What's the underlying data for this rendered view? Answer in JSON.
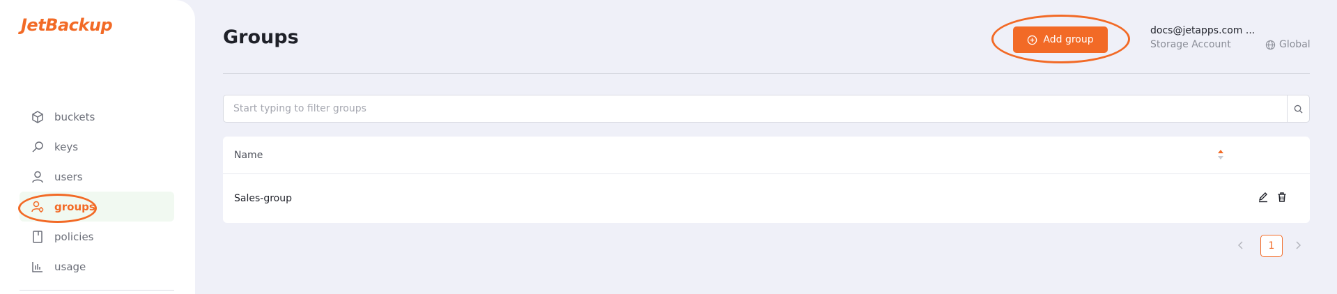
{
  "brand": {
    "logo_text": "JetBackup",
    "accent": "#f26a26"
  },
  "sidebar": {
    "items": [
      {
        "label": "buckets",
        "icon": "cube-icon",
        "active": false
      },
      {
        "label": "keys",
        "icon": "key-icon",
        "active": false
      },
      {
        "label": "users",
        "icon": "user-icon",
        "active": false
      },
      {
        "label": "groups",
        "icon": "users-group-icon",
        "active": true
      },
      {
        "label": "policies",
        "icon": "document-icon",
        "active": false
      },
      {
        "label": "usage",
        "icon": "bar-chart-icon",
        "active": false
      }
    ]
  },
  "header": {
    "title": "Groups",
    "add_button_label": "Add group",
    "account_email": "docs@jetapps.com ...",
    "account_type": "Storage Account",
    "region_label": "Global"
  },
  "search": {
    "placeholder": "Start typing to filter groups",
    "value": ""
  },
  "table": {
    "columns": [
      "Name"
    ],
    "rows": [
      {
        "name": "Sales-group"
      }
    ]
  },
  "pagination": {
    "current_page": "1"
  }
}
